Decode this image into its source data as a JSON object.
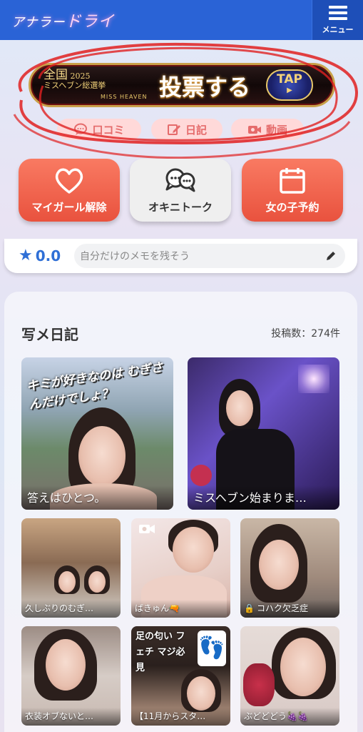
{
  "header": {
    "logo_part1": "アナラー",
    "logo_part2": "ドライ",
    "menu_label": "メニュー"
  },
  "banner": {
    "left_line1": "全国",
    "left_line2": "ミスヘブン総選挙",
    "year": "2025",
    "sub": "MISS HEAVEN",
    "main": "投票する",
    "tap": "TAP"
  },
  "pills": [
    {
      "label": "口コミ",
      "icon": "chat-bubble-icon"
    },
    {
      "label": "日記",
      "icon": "edit-note-icon"
    },
    {
      "label": "動画",
      "icon": "video-camera-icon"
    }
  ],
  "actions": [
    {
      "label": "マイガール解除",
      "icon": "heart-icon"
    },
    {
      "label": "オキニトーク",
      "icon": "speech-bubbles-icon"
    },
    {
      "label": "女の子予約",
      "icon": "calendar-icon"
    }
  ],
  "memo": {
    "rating": "0.0",
    "placeholder": "自分だけのメモを残そう"
  },
  "diary": {
    "title": "写メ日記",
    "count": "投稿数：274件",
    "posts": [
      {
        "caption": "答えはひとつ。",
        "overlay": "キミが好きなのは むぎさんだけでしょ？"
      },
      {
        "caption": "ミスヘブン始まりま…"
      },
      {
        "caption": "久しぶりのむぎ…"
      },
      {
        "caption": "ばきゅん🔫",
        "video": true
      },
      {
        "caption": "コハク欠乏症",
        "locked": true
      },
      {
        "caption": "衣装オブないと…"
      },
      {
        "caption": "【11月からスタ…",
        "overlay": "足の匂い フェチ マジ必見"
      },
      {
        "caption": "ぶどどどう🍇🍇"
      }
    ]
  },
  "colors": {
    "header": "#2a63d6",
    "action_red": "#ef6450",
    "pill_bg": "#ffd9d9",
    "pill_text": "#e56b6b",
    "rating_blue": "#2f6fd6"
  }
}
